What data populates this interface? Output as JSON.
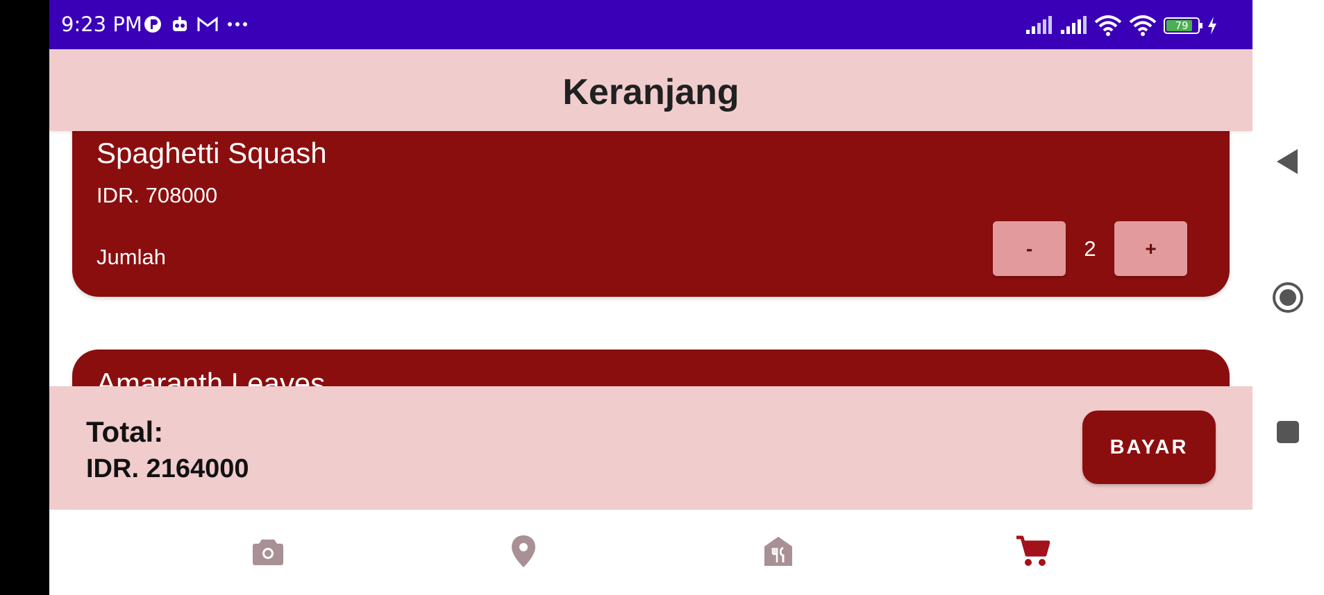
{
  "status_bar": {
    "time": "9:23 PM",
    "battery_level": "79",
    "left_icons": [
      "blocked-notification-icon",
      "robot-app-icon",
      "gmail-icon",
      "more-dots-icon"
    ],
    "right_icons": [
      "signal-bars-icon",
      "signal-bars-icon",
      "wifi-link-icon",
      "hotspot-wifi-icon",
      "battery-icon",
      "charging-bolt-icon"
    ]
  },
  "header": {
    "title": "Keranjang"
  },
  "cart": {
    "items": [
      {
        "name": "Spaghetti Squash",
        "price": "IDR. 708000",
        "qty_label": "Jumlah",
        "quantity": "2",
        "minus": "-",
        "plus": "+"
      },
      {
        "name": "Amaranth Leaves"
      }
    ]
  },
  "total": {
    "label": "Total:",
    "value": "IDR. 2164000",
    "pay_label": "BAYAR"
  },
  "bottom_nav": {
    "items": [
      {
        "icon": "camera-icon",
        "active": false
      },
      {
        "icon": "location-pin-icon",
        "active": false
      },
      {
        "icon": "restaurant-icon",
        "active": false
      },
      {
        "icon": "shopping-cart-icon",
        "active": true
      }
    ]
  },
  "colors": {
    "status_bar": "#3a00b8",
    "app_bar": "#f1cccd",
    "card": "#8b0e0f",
    "qty_button": "#e29a9c",
    "nav_inactive": "#a89095",
    "nav_active": "#a3111c"
  },
  "system_nav": [
    "back-triangle-icon",
    "home-circle-icon",
    "recents-square-icon"
  ]
}
